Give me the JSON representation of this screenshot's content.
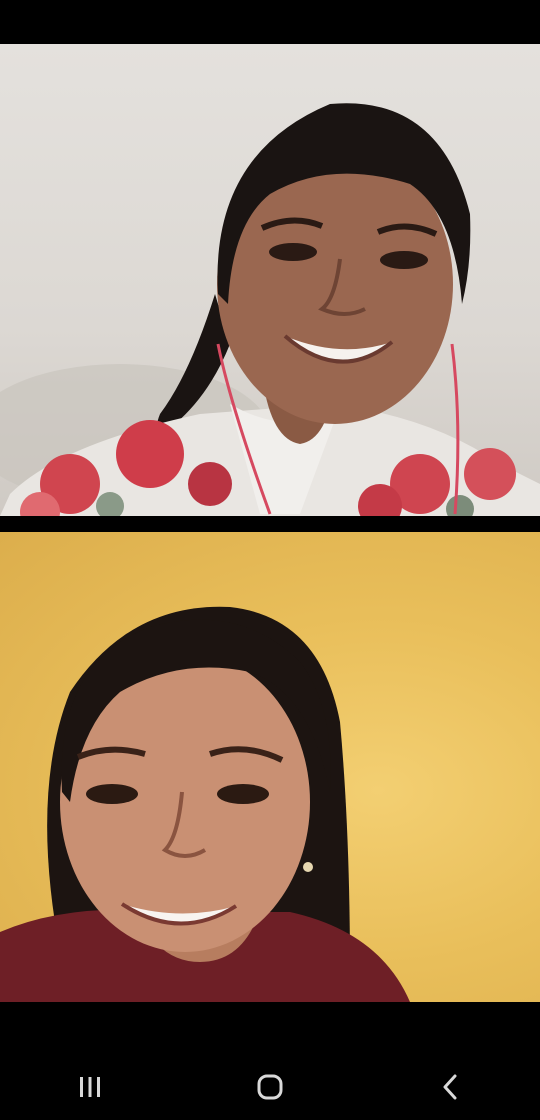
{
  "call": {
    "participants": [
      {
        "position": "top",
        "background_color": "#dcd8d3"
      },
      {
        "position": "bottom",
        "background_color": "#e9bf5b"
      }
    ]
  },
  "navigation": {
    "buttons": [
      {
        "icon": "recent-apps-icon"
      },
      {
        "icon": "home-icon"
      },
      {
        "icon": "back-icon"
      }
    ],
    "icon_color": "#d9d9d9"
  }
}
